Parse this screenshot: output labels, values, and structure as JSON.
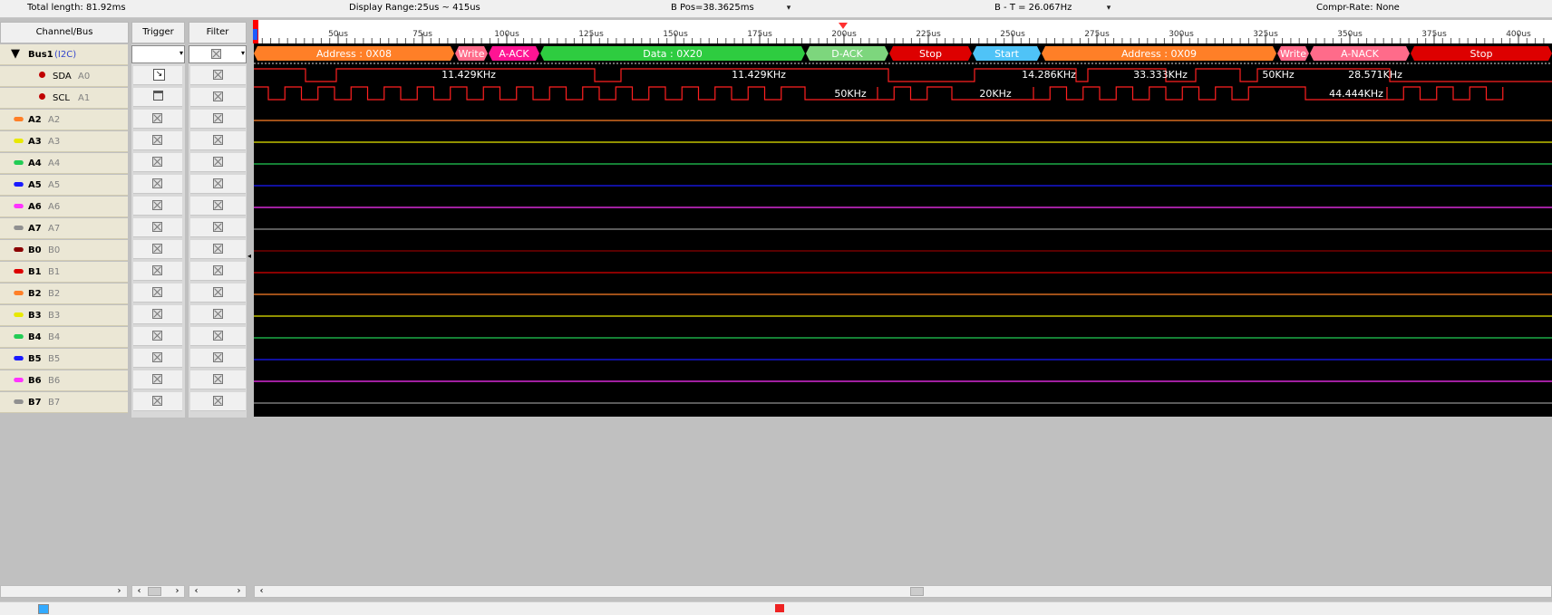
{
  "topbar": {
    "total_length": "Total length: 81.92ms",
    "display_range": "Display Range:25us ~ 415us",
    "b_pos": "B Pos=38.3625ms",
    "b_minus_t": "B - T = 26.067Hz",
    "compr_rate": "Compr-Rate: None"
  },
  "headers": {
    "channel": "Channel/Bus",
    "trigger": "Trigger",
    "filter": "Filter"
  },
  "bus": {
    "name": "Bus1",
    "type": "(I2C)"
  },
  "channels": [
    {
      "name": "SDA",
      "sub": "A0",
      "color": "#c00000",
      "kind": "bullet"
    },
    {
      "name": "SCL",
      "sub": "A1",
      "color": "#c00000",
      "kind": "bullet"
    },
    {
      "name": "A2",
      "sub": "A2",
      "color": "#ff7f27",
      "kind": "icon"
    },
    {
      "name": "A3",
      "sub": "A3",
      "color": "#e8e800",
      "kind": "icon"
    },
    {
      "name": "A4",
      "sub": "A4",
      "color": "#22cc55",
      "kind": "icon"
    },
    {
      "name": "A5",
      "sub": "A5",
      "color": "#1a1aff",
      "kind": "icon"
    },
    {
      "name": "A6",
      "sub": "A6",
      "color": "#ff33ff",
      "kind": "icon"
    },
    {
      "name": "A7",
      "sub": "A7",
      "color": "#909090",
      "kind": "icon"
    },
    {
      "name": "B0",
      "sub": "B0",
      "color": "#8b0000",
      "kind": "icon"
    },
    {
      "name": "B1",
      "sub": "B1",
      "color": "#dd0000",
      "kind": "icon"
    },
    {
      "name": "B2",
      "sub": "B2",
      "color": "#ff7f27",
      "kind": "icon"
    },
    {
      "name": "B3",
      "sub": "B3",
      "color": "#e8e800",
      "kind": "icon"
    },
    {
      "name": "B4",
      "sub": "B4",
      "color": "#22cc55",
      "kind": "icon"
    },
    {
      "name": "B5",
      "sub": "B5",
      "color": "#1a1aff",
      "kind": "icon"
    },
    {
      "name": "B6",
      "sub": "B6",
      "color": "#ff33ff",
      "kind": "icon"
    },
    {
      "name": "B7",
      "sub": "B7",
      "color": "#909090",
      "kind": "icon"
    }
  ],
  "ruler_labels": [
    "50us",
    "75us",
    "100us",
    "125us",
    "150us",
    "175us",
    "200us",
    "225us",
    "250us",
    "275us",
    "300us",
    "325us",
    "350us",
    "375us",
    "400us"
  ],
  "decode": [
    {
      "label": "Address : 0X08",
      "color": "#ff7f27"
    },
    {
      "label": "Write",
      "color": "#ff6b8a"
    },
    {
      "label": "A-ACK",
      "color": "#ff1493"
    },
    {
      "label": "Data : 0X20",
      "color": "#2ecc40"
    },
    {
      "label": "D-ACK",
      "color": "#7dd67d"
    },
    {
      "label": "Stop",
      "color": "#dd0000"
    },
    {
      "label": "Start",
      "color": "#4fc3f7"
    },
    {
      "label": "Address : 0X09",
      "color": "#ff7f27"
    },
    {
      "label": "Write",
      "color": "#ff6b8a"
    },
    {
      "label": "A-NACK",
      "color": "#ff6b8a"
    },
    {
      "label": "Stop",
      "color": "#dd0000"
    }
  ],
  "sda_labels": [
    "11.429KHz",
    "11.429KHz",
    "14.286KHz",
    "33.333KHz",
    "50KHz",
    "28.571KHz"
  ],
  "scl_labels": [
    "50KHz",
    "20KHz",
    "44.444KHz"
  ],
  "colors": {
    "wave_red": "#ff2020"
  }
}
